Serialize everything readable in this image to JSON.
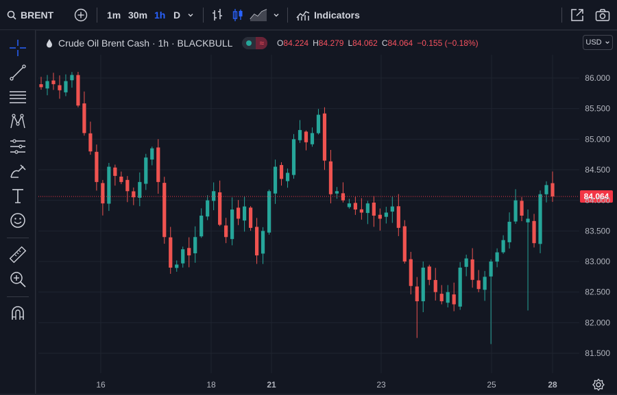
{
  "toolbar": {
    "symbol": "BRENT",
    "timeframes": [
      "1m",
      "30m",
      "1h",
      "D"
    ],
    "active_timeframe": "1h",
    "indicators_label": "Indicators",
    "icons": [
      "search-icon",
      "add-symbol-icon",
      "chevron-down-icon",
      "bar-chart-icon",
      "candles-icon",
      "area-chart-icon",
      "indicators-icon",
      "snapshot-share-icon",
      "camera-icon"
    ]
  },
  "left_tools": [
    "crosshair-icon",
    "trend-line-icon",
    "fib-icon",
    "pattern-icon",
    "projection-icon",
    "brush-icon",
    "text-icon",
    "emoji-icon",
    "ruler-icon",
    "zoom-in-icon",
    "magnet-icon"
  ],
  "legend": {
    "title": "Crude Oil Brent Cash · 1h · BLACKBULL",
    "o_label": "O",
    "o": "84.224",
    "h_label": "H",
    "h": "84.279",
    "l_label": "L",
    "l": "84.062",
    "c_label": "C",
    "c": "84.064",
    "change": "−0.155 (−0.18%)"
  },
  "currency": "USD",
  "colors": {
    "up": "#26a69a",
    "down": "#ef5350",
    "background": "#131722",
    "grid": "#1f2430",
    "last_price": "#f23645",
    "active": "#2962ff"
  },
  "chart_data": {
    "type": "candlestick",
    "symbol": "Crude Oil Brent Cash",
    "interval": "1h",
    "source": "BLACKBULL",
    "ylim": [
      81.2,
      86.4
    ],
    "y_ticks": [
      "86.000",
      "85.500",
      "85.000",
      "84.500",
      "84.000",
      "83.500",
      "83.000",
      "82.500",
      "82.000",
      "81.500"
    ],
    "x_ticks": [
      "16",
      "18",
      "21",
      "23",
      "25",
      "28"
    ],
    "last_price": "84.064",
    "grid": true,
    "approx_close_path": [
      85.85,
      85.95,
      85.9,
      85.8,
      85.95,
      86.05,
      85.55,
      85.1,
      84.8,
      84.3,
      83.95,
      84.55,
      84.4,
      84.3,
      84.15,
      84.05,
      84.3,
      84.7,
      84.85,
      84.3,
      83.4,
      82.9,
      82.95,
      83.2,
      83.1,
      83.4,
      83.75,
      84.0,
      84.15,
      83.6,
      83.4,
      83.85,
      83.7,
      83.9,
      83.55,
      83.1,
      83.5,
      84.15,
      84.55,
      84.35,
      84.45,
      85.0,
      85.15,
      84.95,
      85.1,
      85.4,
      84.65,
      84.1,
      84.15,
      84.0,
      83.95,
      83.85,
      83.8,
      83.95,
      83.75,
      83.7,
      83.8,
      83.9,
      83.55,
      83.0,
      82.6,
      82.35,
      82.9,
      82.7,
      82.5,
      82.35,
      82.5,
      82.3,
      82.9,
      83.05,
      82.7,
      82.55,
      82.75,
      83.0,
      83.15,
      83.35,
      83.65,
      84.0,
      83.75,
      83.7,
      83.3,
      84.1,
      84.25,
      84.064
    ]
  },
  "bottom": {
    "settings_icon": "settings-icon"
  }
}
